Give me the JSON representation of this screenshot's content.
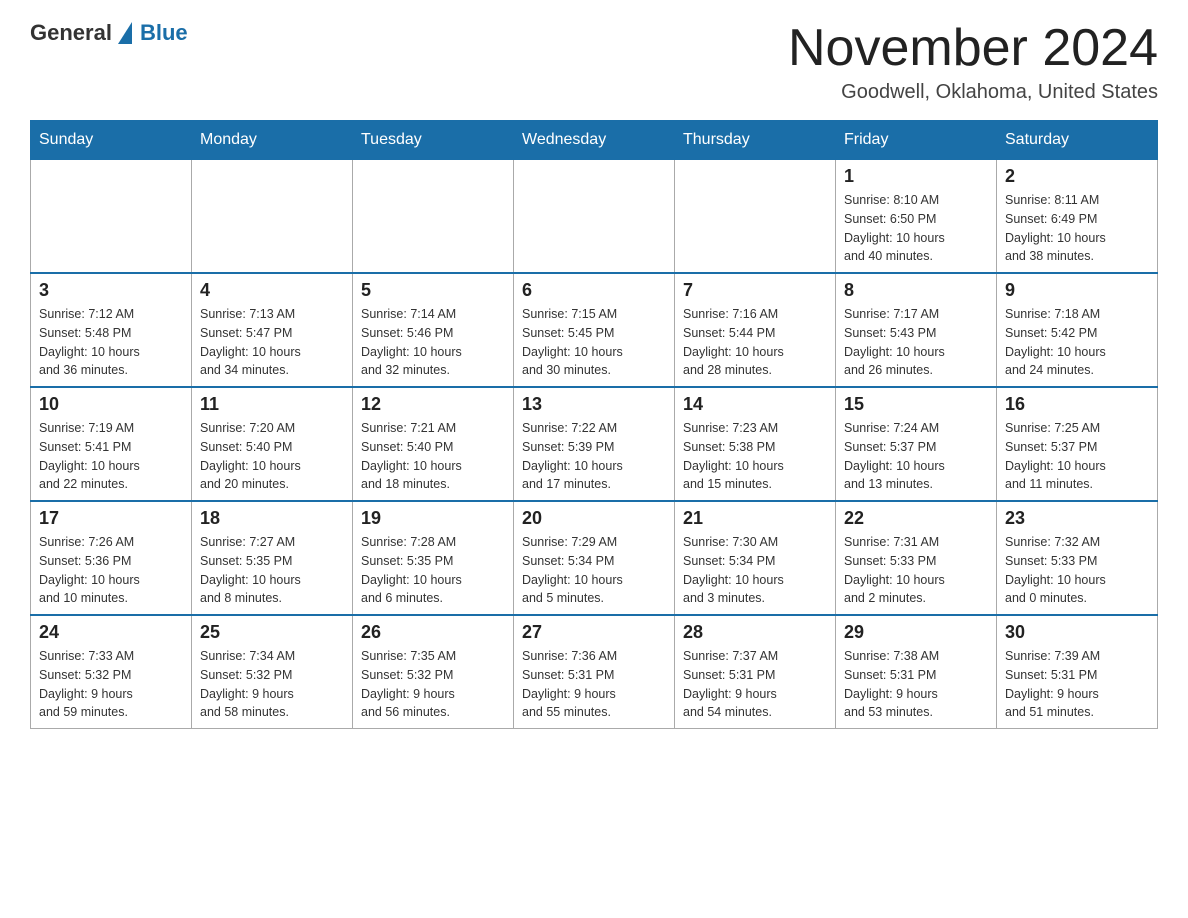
{
  "logo": {
    "text_general": "General",
    "text_blue": "Blue"
  },
  "title": "November 2024",
  "subtitle": "Goodwell, Oklahoma, United States",
  "weekdays": [
    "Sunday",
    "Monday",
    "Tuesday",
    "Wednesday",
    "Thursday",
    "Friday",
    "Saturday"
  ],
  "weeks": [
    [
      {
        "day": "",
        "info": ""
      },
      {
        "day": "",
        "info": ""
      },
      {
        "day": "",
        "info": ""
      },
      {
        "day": "",
        "info": ""
      },
      {
        "day": "",
        "info": ""
      },
      {
        "day": "1",
        "info": "Sunrise: 8:10 AM\nSunset: 6:50 PM\nDaylight: 10 hours\nand 40 minutes."
      },
      {
        "day": "2",
        "info": "Sunrise: 8:11 AM\nSunset: 6:49 PM\nDaylight: 10 hours\nand 38 minutes."
      }
    ],
    [
      {
        "day": "3",
        "info": "Sunrise: 7:12 AM\nSunset: 5:48 PM\nDaylight: 10 hours\nand 36 minutes."
      },
      {
        "day": "4",
        "info": "Sunrise: 7:13 AM\nSunset: 5:47 PM\nDaylight: 10 hours\nand 34 minutes."
      },
      {
        "day": "5",
        "info": "Sunrise: 7:14 AM\nSunset: 5:46 PM\nDaylight: 10 hours\nand 32 minutes."
      },
      {
        "day": "6",
        "info": "Sunrise: 7:15 AM\nSunset: 5:45 PM\nDaylight: 10 hours\nand 30 minutes."
      },
      {
        "day": "7",
        "info": "Sunrise: 7:16 AM\nSunset: 5:44 PM\nDaylight: 10 hours\nand 28 minutes."
      },
      {
        "day": "8",
        "info": "Sunrise: 7:17 AM\nSunset: 5:43 PM\nDaylight: 10 hours\nand 26 minutes."
      },
      {
        "day": "9",
        "info": "Sunrise: 7:18 AM\nSunset: 5:42 PM\nDaylight: 10 hours\nand 24 minutes."
      }
    ],
    [
      {
        "day": "10",
        "info": "Sunrise: 7:19 AM\nSunset: 5:41 PM\nDaylight: 10 hours\nand 22 minutes."
      },
      {
        "day": "11",
        "info": "Sunrise: 7:20 AM\nSunset: 5:40 PM\nDaylight: 10 hours\nand 20 minutes."
      },
      {
        "day": "12",
        "info": "Sunrise: 7:21 AM\nSunset: 5:40 PM\nDaylight: 10 hours\nand 18 minutes."
      },
      {
        "day": "13",
        "info": "Sunrise: 7:22 AM\nSunset: 5:39 PM\nDaylight: 10 hours\nand 17 minutes."
      },
      {
        "day": "14",
        "info": "Sunrise: 7:23 AM\nSunset: 5:38 PM\nDaylight: 10 hours\nand 15 minutes."
      },
      {
        "day": "15",
        "info": "Sunrise: 7:24 AM\nSunset: 5:37 PM\nDaylight: 10 hours\nand 13 minutes."
      },
      {
        "day": "16",
        "info": "Sunrise: 7:25 AM\nSunset: 5:37 PM\nDaylight: 10 hours\nand 11 minutes."
      }
    ],
    [
      {
        "day": "17",
        "info": "Sunrise: 7:26 AM\nSunset: 5:36 PM\nDaylight: 10 hours\nand 10 minutes."
      },
      {
        "day": "18",
        "info": "Sunrise: 7:27 AM\nSunset: 5:35 PM\nDaylight: 10 hours\nand 8 minutes."
      },
      {
        "day": "19",
        "info": "Sunrise: 7:28 AM\nSunset: 5:35 PM\nDaylight: 10 hours\nand 6 minutes."
      },
      {
        "day": "20",
        "info": "Sunrise: 7:29 AM\nSunset: 5:34 PM\nDaylight: 10 hours\nand 5 minutes."
      },
      {
        "day": "21",
        "info": "Sunrise: 7:30 AM\nSunset: 5:34 PM\nDaylight: 10 hours\nand 3 minutes."
      },
      {
        "day": "22",
        "info": "Sunrise: 7:31 AM\nSunset: 5:33 PM\nDaylight: 10 hours\nand 2 minutes."
      },
      {
        "day": "23",
        "info": "Sunrise: 7:32 AM\nSunset: 5:33 PM\nDaylight: 10 hours\nand 0 minutes."
      }
    ],
    [
      {
        "day": "24",
        "info": "Sunrise: 7:33 AM\nSunset: 5:32 PM\nDaylight: 9 hours\nand 59 minutes."
      },
      {
        "day": "25",
        "info": "Sunrise: 7:34 AM\nSunset: 5:32 PM\nDaylight: 9 hours\nand 58 minutes."
      },
      {
        "day": "26",
        "info": "Sunrise: 7:35 AM\nSunset: 5:32 PM\nDaylight: 9 hours\nand 56 minutes."
      },
      {
        "day": "27",
        "info": "Sunrise: 7:36 AM\nSunset: 5:31 PM\nDaylight: 9 hours\nand 55 minutes."
      },
      {
        "day": "28",
        "info": "Sunrise: 7:37 AM\nSunset: 5:31 PM\nDaylight: 9 hours\nand 54 minutes."
      },
      {
        "day": "29",
        "info": "Sunrise: 7:38 AM\nSunset: 5:31 PM\nDaylight: 9 hours\nand 53 minutes."
      },
      {
        "day": "30",
        "info": "Sunrise: 7:39 AM\nSunset: 5:31 PM\nDaylight: 9 hours\nand 51 minutes."
      }
    ]
  ]
}
